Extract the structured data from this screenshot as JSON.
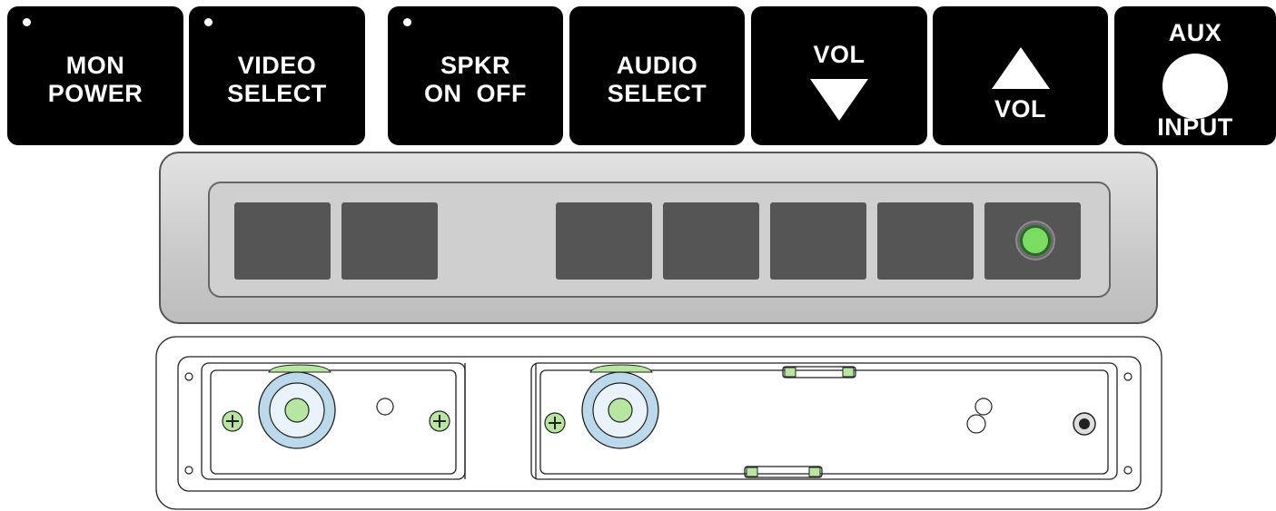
{
  "keys": [
    {
      "line1": "MON",
      "line2": "POWER",
      "led": true
    },
    {
      "line1": "VIDEO",
      "line2": "SELECT",
      "led": true
    },
    {
      "line1": "SPKR",
      "line2": "ON  OFF",
      "led": true
    },
    {
      "line1": "AUDIO",
      "line2": "SELECT",
      "led": false
    }
  ],
  "vol_down": {
    "label": "VOL",
    "icon": "triangle-down-icon"
  },
  "vol_up": {
    "label": "VOL",
    "icon": "triangle-up-icon"
  },
  "aux": {
    "top": "AUX",
    "bottom": "INPUT",
    "icon": "circle-jack-icon"
  },
  "colors": {
    "key_bg": "#000000",
    "key_text": "#ffffff",
    "pad": "#555555",
    "indicator_led": "#7bdc62",
    "rear_accent_green": "#b7e6a0",
    "rear_accent_blue": "#bcd9ec"
  }
}
